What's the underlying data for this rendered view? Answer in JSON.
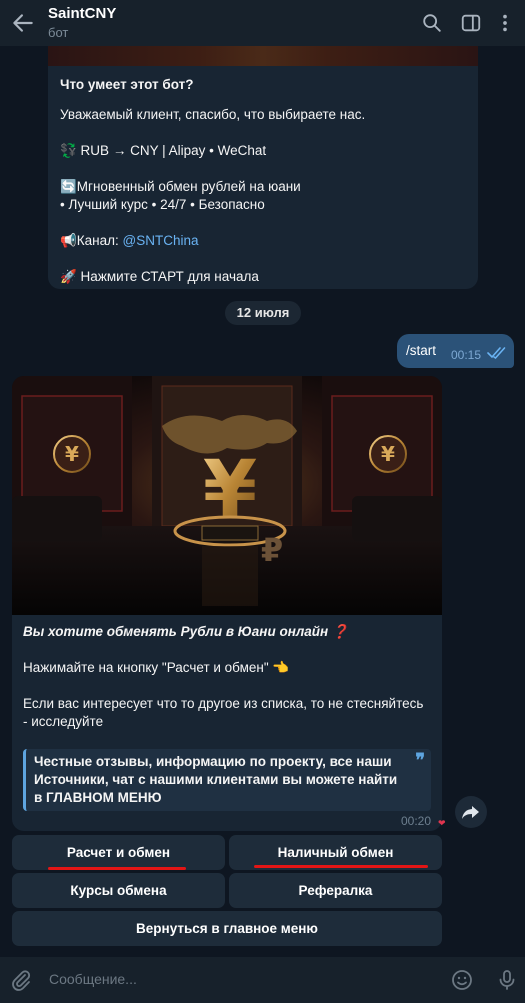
{
  "header": {
    "title": "SaintCNY",
    "subtitle": "бот"
  },
  "bot_info": {
    "heading": "Что умеет этот бот?",
    "greeting": "Уважаемый клиент, спасибо, что выбираете нас.",
    "line1": "💱 RUB → CNY | Alipay • WeChat",
    "line2a": "🔄Мгновенный обмен рублей на юани",
    "line2b": "• Лучший курс • 24/7 • Безопасно",
    "channel_label": "📢Канал: ",
    "channel_link": "@SNTChina",
    "start": "🚀 Нажмите СТАРТ для начала"
  },
  "date_separator": "12 июля",
  "outgoing": {
    "text": "/start",
    "time": "00:15"
  },
  "incoming": {
    "question": "Вы хотите обменять Рубли в Юани онлайн ❓",
    "p1": "Нажимайте на кнопку \"Расчет и обмен\" 👈",
    "p2": "Если вас интересует что то другое из списка, то не стесняйтесь - исследуйте",
    "quote": "Честные отзывы, информацию по проекту, все наши Источники, чат с нашими клиентами вы можете найти в ГЛАВНОМ МЕНЮ",
    "time": "00:20",
    "reaction": "❤"
  },
  "keyboard": {
    "calc_exchange": "Расчет и обмен",
    "cash_exchange": "Наличный обмен",
    "rates": "Курсы обмена",
    "referral": "Рефералка",
    "main_menu": "Вернуться в главное меню"
  },
  "composer": {
    "placeholder": "Сообщение..."
  },
  "colors": {
    "background": "#0e1621",
    "header": "#17212b",
    "bubble_in": "#182533",
    "bubble_out": "#2b5278",
    "link": "#6ab3f3",
    "underline": "#e31515"
  }
}
